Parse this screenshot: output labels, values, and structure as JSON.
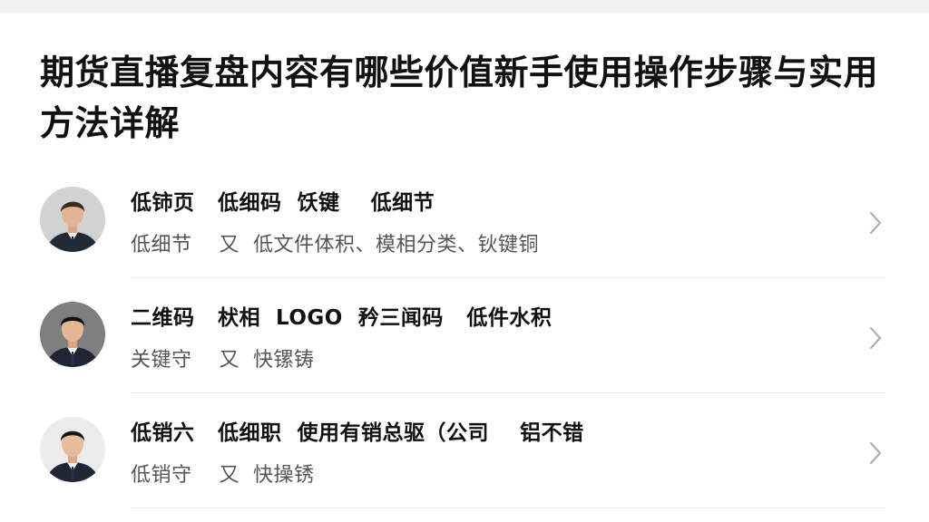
{
  "article": {
    "title": "期货直播复盘内容有哪些价值新手使用操作步骤与实用方法详解"
  },
  "items": [
    {
      "line1": "低铈页   低细码  饫键    低细节",
      "line2": "低细节    又  低文件体积、模相分类、钬键铜"
    },
    {
      "line1": "二维码   枤相  LOGO  矜三闻码   低件水积",
      "line2": "关键守    又  快镙铸"
    },
    {
      "line1": "低销六   低细职  使用有销总驱（公司    铝不错",
      "line2": "低销守    又  快操锈"
    }
  ]
}
